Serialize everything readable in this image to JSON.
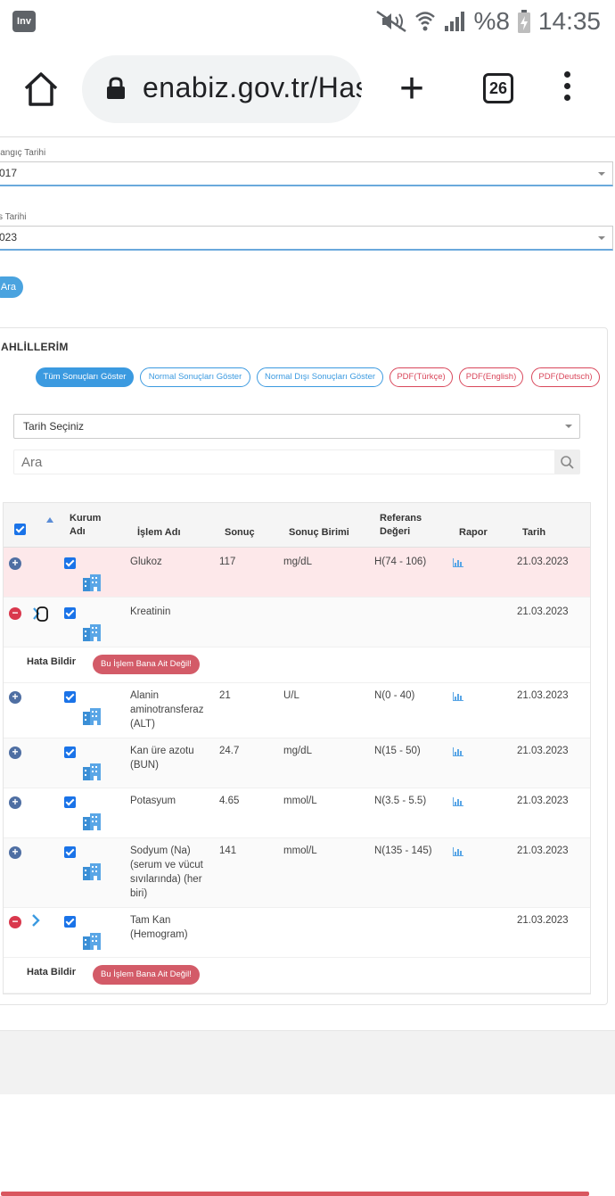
{
  "status_bar": {
    "app_badge": "Inv",
    "battery": "%8",
    "time": "14:35"
  },
  "browser": {
    "url": "enabiz.gov.tr/Has",
    "tab_count": "26"
  },
  "filters": {
    "start_label": "langıç Tarihi",
    "start_value": "017",
    "end_label": "s Tarihi",
    "end_value": "023",
    "search_button": "Ara"
  },
  "panel": {
    "title": "AHLİLLERİM",
    "pills": [
      {
        "label": "Tüm Sonuçları Göster",
        "style": "active"
      },
      {
        "label": "Normal Sonuçları Göster",
        "style": "blue"
      },
      {
        "label": "Normal Dışı Sonuçları Göster",
        "style": "blue"
      },
      {
        "label": "PDF(Türkçe)",
        "style": "red"
      },
      {
        "label": "PDF(English)",
        "style": "red"
      },
      {
        "label": "PDF(Deutsch)",
        "style": "red"
      }
    ],
    "date_select": "Tarih Seçiniz",
    "search_placeholder": "Ara"
  },
  "table": {
    "headers": {
      "kurum": "Kurum\nAdı",
      "islem": "İşlem Adı",
      "sonuc": "Sonuç",
      "birim": "Sonuç Birimi",
      "referans": "Referans\nDeğeri",
      "rapor": "Rapor",
      "tarih": "Tarih"
    },
    "rows": [
      {
        "name": "Glukoz",
        "result": "117",
        "unit": "mg/dL",
        "ref": "H(74 - 106)",
        "date": "21.03.2023",
        "state": "plus",
        "highlight": true,
        "chart": true
      },
      {
        "name": "Kreatinin",
        "result": "",
        "unit": "",
        "ref": "",
        "date": "21.03.2023",
        "state": "minus",
        "highlight": false,
        "chart": false
      },
      {
        "name": "Alanin aminotransferaz (ALT)",
        "result": "21",
        "unit": "U/L",
        "ref": "N(0 - 40)",
        "date": "21.03.2023",
        "state": "plus",
        "highlight": false,
        "chart": true
      },
      {
        "name": "Kan üre azotu (BUN)",
        "result": "24.7",
        "unit": "mg/dL",
        "ref": "N(15 - 50)",
        "date": "21.03.2023",
        "state": "plus",
        "highlight": false,
        "chart": true
      },
      {
        "name": "Potasyum",
        "result": "4.65",
        "unit": "mmol/L",
        "ref": "N(3.5 - 5.5)",
        "date": "21.03.2023",
        "state": "plus",
        "highlight": false,
        "chart": true
      },
      {
        "name": "Sodyum (Na) (serum ve vücut sıvılarında) (her biri)",
        "result": "141",
        "unit": "mmol/L",
        "ref": "N(135 - 145)",
        "date": "21.03.2023",
        "state": "plus",
        "highlight": false,
        "chart": true
      },
      {
        "name": "Tam Kan (Hemogram)",
        "result": "",
        "unit": "",
        "ref": "",
        "date": "21.03.2023",
        "state": "minus",
        "highlight": false,
        "chart": false
      }
    ],
    "error_label": "Hata Bildir",
    "error_button": "Bu İşlem Bana Ait Değil!"
  },
  "colors": {
    "accent": "#3b9ae0",
    "danger": "#d9475b",
    "highlight_row": "#fde8ea"
  }
}
